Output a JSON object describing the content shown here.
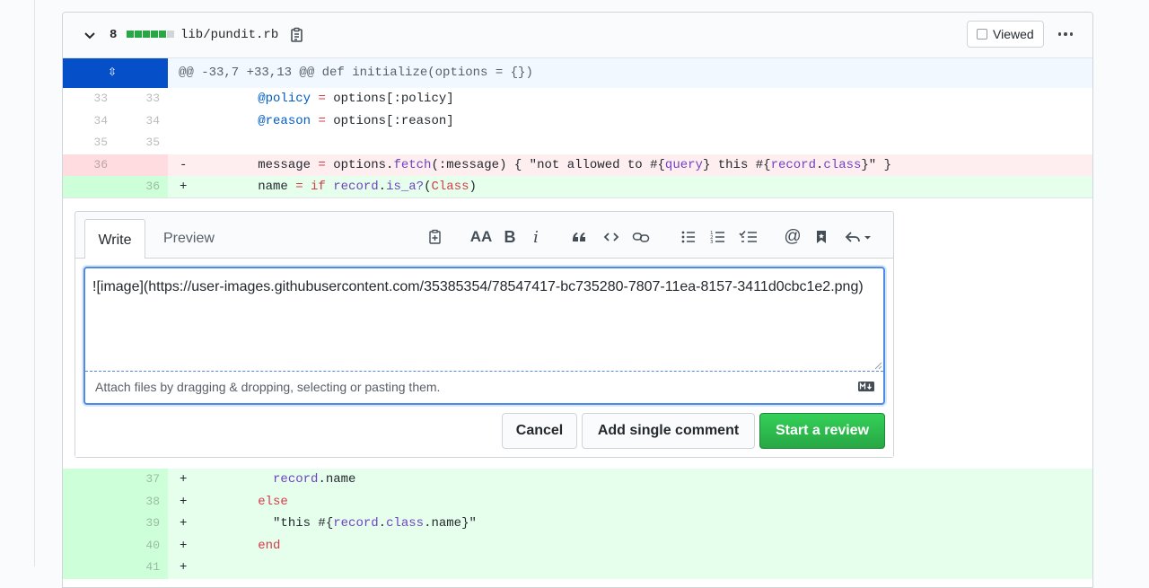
{
  "file": {
    "changes": "8",
    "diffstat": [
      "#28a745",
      "#28a745",
      "#28a745",
      "#28a745",
      "#28a745",
      "#d1d5da"
    ],
    "name": "lib/pundit.rb",
    "viewed_label": "Viewed"
  },
  "hunk": {
    "expand_glyph": "⇳",
    "header": "@@ -33,7 +33,13 @@ def initialize(options = {})"
  },
  "lines_top": [
    {
      "type": "ctx",
      "old": "33",
      "new": "33",
      "sign": "",
      "tokens": [
        [
          "",
          "        "
        ],
        [
          "ct",
          "@policy"
        ],
        [
          "",
          " "
        ],
        [
          "kw",
          "="
        ],
        [
          "",
          " options[:policy]"
        ]
      ]
    },
    {
      "type": "ctx",
      "old": "34",
      "new": "34",
      "sign": "",
      "tokens": [
        [
          "",
          "        "
        ],
        [
          "ct",
          "@reason"
        ],
        [
          "",
          " "
        ],
        [
          "kw",
          "="
        ],
        [
          "",
          " options[:reason]"
        ]
      ]
    },
    {
      "type": "ctx",
      "old": "35",
      "new": "35",
      "sign": "",
      "tokens": []
    },
    {
      "type": "del",
      "old": "36",
      "new": "",
      "sign": "-",
      "tokens": [
        [
          "",
          "        message "
        ],
        [
          "kw",
          "="
        ],
        [
          "",
          " options."
        ],
        [
          "fn",
          "fetch"
        ],
        [
          "",
          "(:message) { \"not allowed to #{"
        ],
        [
          "fn",
          "query"
        ],
        [
          "",
          "} this #{"
        ],
        [
          "fn",
          "record"
        ],
        [
          "",
          "."
        ],
        [
          "fn",
          "class"
        ],
        [
          "",
          "}\" }"
        ]
      ]
    },
    {
      "type": "add",
      "old": "",
      "new": "36",
      "sign": "+",
      "tokens": [
        [
          "",
          "        name "
        ],
        [
          "kw",
          "="
        ],
        [
          "",
          " "
        ],
        [
          "kw",
          "if"
        ],
        [
          "",
          " "
        ],
        [
          "fn",
          "record"
        ],
        [
          "",
          "."
        ],
        [
          "fn",
          "is_a?"
        ],
        [
          "",
          "("
        ],
        [
          "kw",
          "Class"
        ],
        [
          "",
          ")"
        ]
      ]
    }
  ],
  "lines_bottom": [
    {
      "type": "add",
      "old": "",
      "new": "37",
      "sign": "+",
      "tokens": [
        [
          "",
          "          "
        ],
        [
          "fn",
          "record"
        ],
        [
          "",
          ".name"
        ]
      ]
    },
    {
      "type": "add",
      "old": "",
      "new": "38",
      "sign": "+",
      "tokens": [
        [
          "",
          "        "
        ],
        [
          "kw",
          "else"
        ]
      ]
    },
    {
      "type": "add",
      "old": "",
      "new": "39",
      "sign": "+",
      "tokens": [
        [
          "",
          "          \"this #{"
        ],
        [
          "fn",
          "record"
        ],
        [
          "",
          "."
        ],
        [
          "fn",
          "class"
        ],
        [
          "",
          ".name}\""
        ]
      ]
    },
    {
      "type": "add",
      "old": "",
      "new": "40",
      "sign": "+",
      "tokens": [
        [
          "",
          "        "
        ],
        [
          "kw",
          "end"
        ]
      ]
    },
    {
      "type": "add",
      "old": "",
      "new": "41",
      "sign": "+",
      "tokens": []
    }
  ],
  "comment": {
    "tab_write": "Write",
    "tab_preview": "Preview",
    "toolbar_text": {
      "header": "AA",
      "bold": "B",
      "italic": "i"
    },
    "editor_value": "![image](https://user-images.githubusercontent.com/35385354/78547417-bc735280-7807-11ea-8157-3411d0cbc1e2.png)",
    "attach_hint": "Attach files by dragging & dropping, selecting or pasting them.",
    "cancel_label": "Cancel",
    "single_comment_label": "Add single comment",
    "start_review_label": "Start a review"
  }
}
